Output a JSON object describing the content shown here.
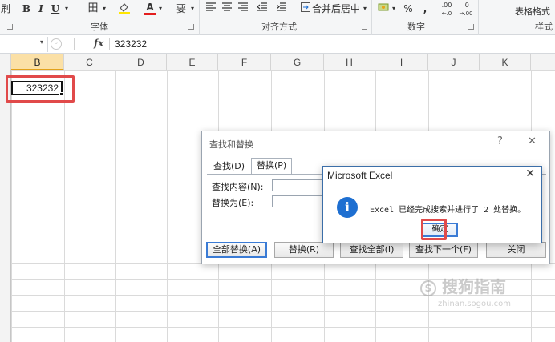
{
  "ribbon": {
    "partial_left_label": "刷",
    "font_buttons": [
      "B",
      "I",
      "U"
    ],
    "border_icon": "田",
    "font_color_label": "A",
    "wen_label": "要",
    "merge_label": "合并后居中",
    "percent_label": "%",
    "comma_label": ",",
    "inc_decimal": ".00",
    "dec_decimal": ".0",
    "table_format_label": "表格格式",
    "groups": {
      "font": "字体",
      "alignment": "对齐方式",
      "number": "数字",
      "style": "样式"
    }
  },
  "formula_bar": {
    "fx": "fx",
    "value": "323232"
  },
  "columns": [
    "B",
    "C",
    "D",
    "E",
    "F",
    "G",
    "H",
    "I",
    "J",
    "K"
  ],
  "cell_b2": {
    "value": "323232"
  },
  "find_replace": {
    "title": "查找和替换",
    "help": "?",
    "close": "✕",
    "tabs": [
      "查找(D)",
      "替换(P)"
    ],
    "find_label": "查找内容(N):",
    "replace_label": "替换为(E):",
    "buttons": {
      "replace_all": "全部替换(A)",
      "replace": "替换(R)",
      "find_all": "查找全部(I)",
      "find_next": "查找下一个(F)",
      "close": "关闭"
    }
  },
  "message_box": {
    "title": "Microsoft Excel",
    "close": "✕",
    "icon": "i",
    "text": "Excel 已经完成搜索并进行了 2 处替换。",
    "ok": "确定"
  },
  "watermark": {
    "text": "搜狗指南",
    "sub": "zhinan.sogou.com"
  }
}
